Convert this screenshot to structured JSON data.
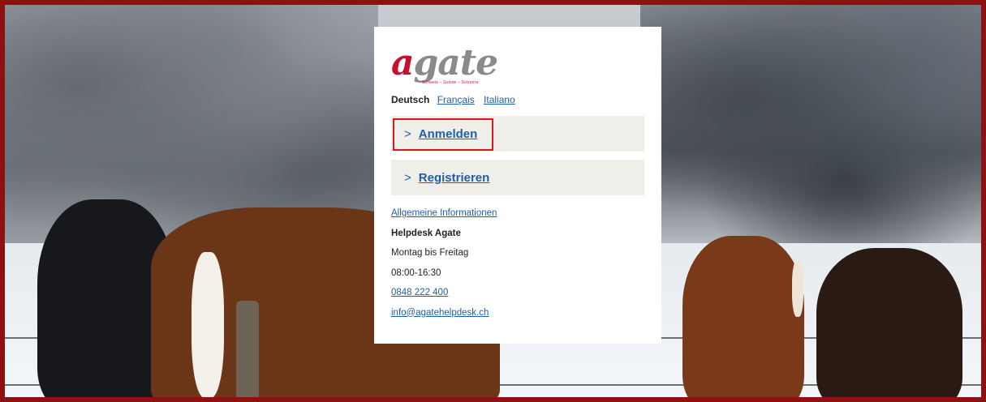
{
  "logo": {
    "text_a": "a",
    "text_rest": "gate",
    "tagline": "Schweiz – Suisse – Svizzera"
  },
  "languages": {
    "current": "Deutsch",
    "others": [
      "Français",
      "Italiano"
    ]
  },
  "actions": {
    "login_label": "Anmelden",
    "register_label": "Registrieren"
  },
  "info": {
    "general_link": "Allgemeine Informationen",
    "helpdesk_title": "Helpdesk Agate",
    "days": "Montag bis Freitag",
    "hours": "08:00-16:30",
    "phone": "0848 222 400",
    "email": "info@agatehelpdesk.ch"
  },
  "colors": {
    "brand_red": "#c8102e",
    "link_blue": "#1f5fa8",
    "button_bg": "#f0eee9",
    "frame": "#8e1111"
  }
}
